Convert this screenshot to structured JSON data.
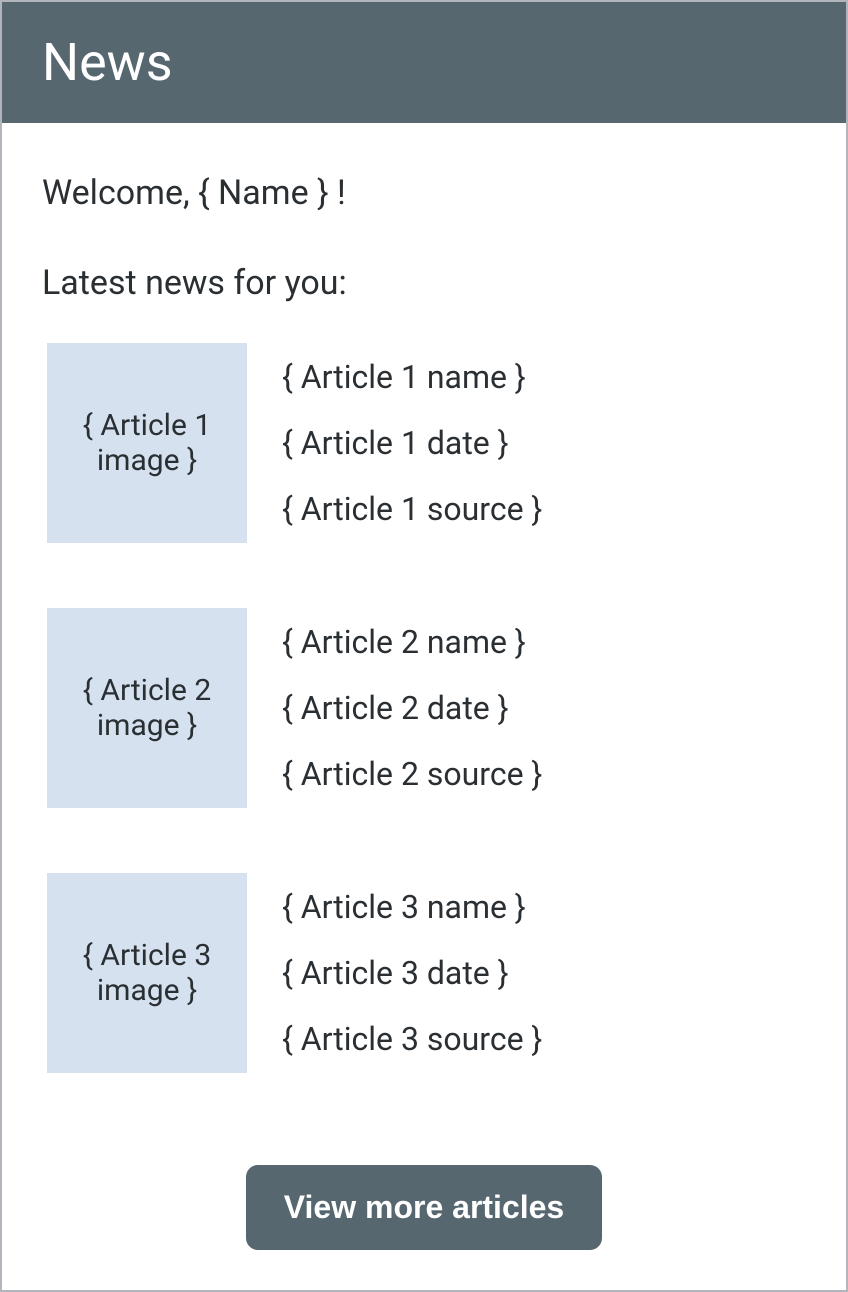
{
  "header": {
    "title": "News"
  },
  "welcome": {
    "prefix": "Welcome, ",
    "name_placeholder": "{ Name }",
    "suffix": " !"
  },
  "subtitle": "Latest news for you:",
  "articles": [
    {
      "image": "{ Article 1 image }",
      "name": "{ Article 1 name }",
      "date": "{ Article 1 date }",
      "source": "{ Article 1 source }"
    },
    {
      "image": "{ Article 2 image }",
      "name": "{ Article 2 name }",
      "date": "{ Article 2 date }",
      "source": "{ Article 2 source }"
    },
    {
      "image": "{ Article 3 image }",
      "name": "{ Article 3 name }",
      "date": "{ Article 3 date }",
      "source": "{ Article 3 source }"
    }
  ],
  "button": {
    "view_more": "View more articles"
  }
}
